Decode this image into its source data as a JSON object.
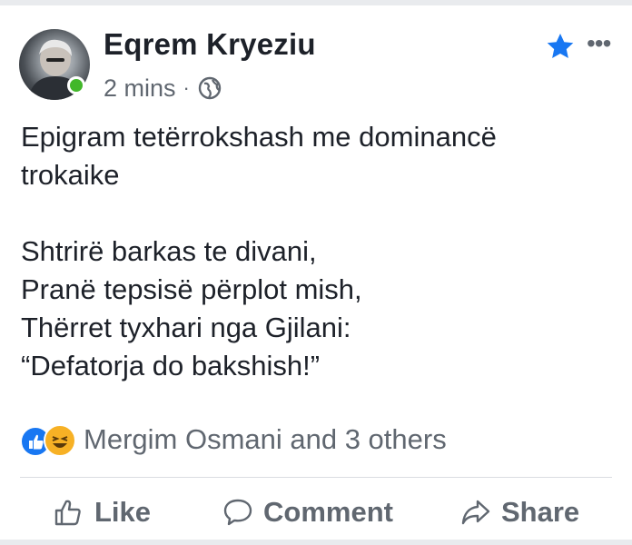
{
  "post": {
    "author": "Eqrem Kryeziu",
    "timestamp": "2 mins",
    "separator": "·",
    "privacy_icon": "globe-icon",
    "lines": [
      "Epigram tetërrokshash me dominancë",
      "trokaike",
      "",
      "Shtrirë barkas te divani,",
      "Pranë tepsisë përplot mish,",
      "Thërret tyxhari nga Gjilani:",
      "“Defatorja do bakshish!”"
    ]
  },
  "reactions": {
    "icons": [
      "like-reaction-icon",
      "haha-reaction-icon"
    ],
    "summary": "Mergim Osmani and 3 others"
  },
  "actions": {
    "like_label": "Like",
    "comment_label": "Comment",
    "share_label": "Share"
  },
  "colors": {
    "accent": "#1877f2",
    "online": "#42b72a",
    "muted_text": "#606770",
    "haha": "#f7b125"
  }
}
